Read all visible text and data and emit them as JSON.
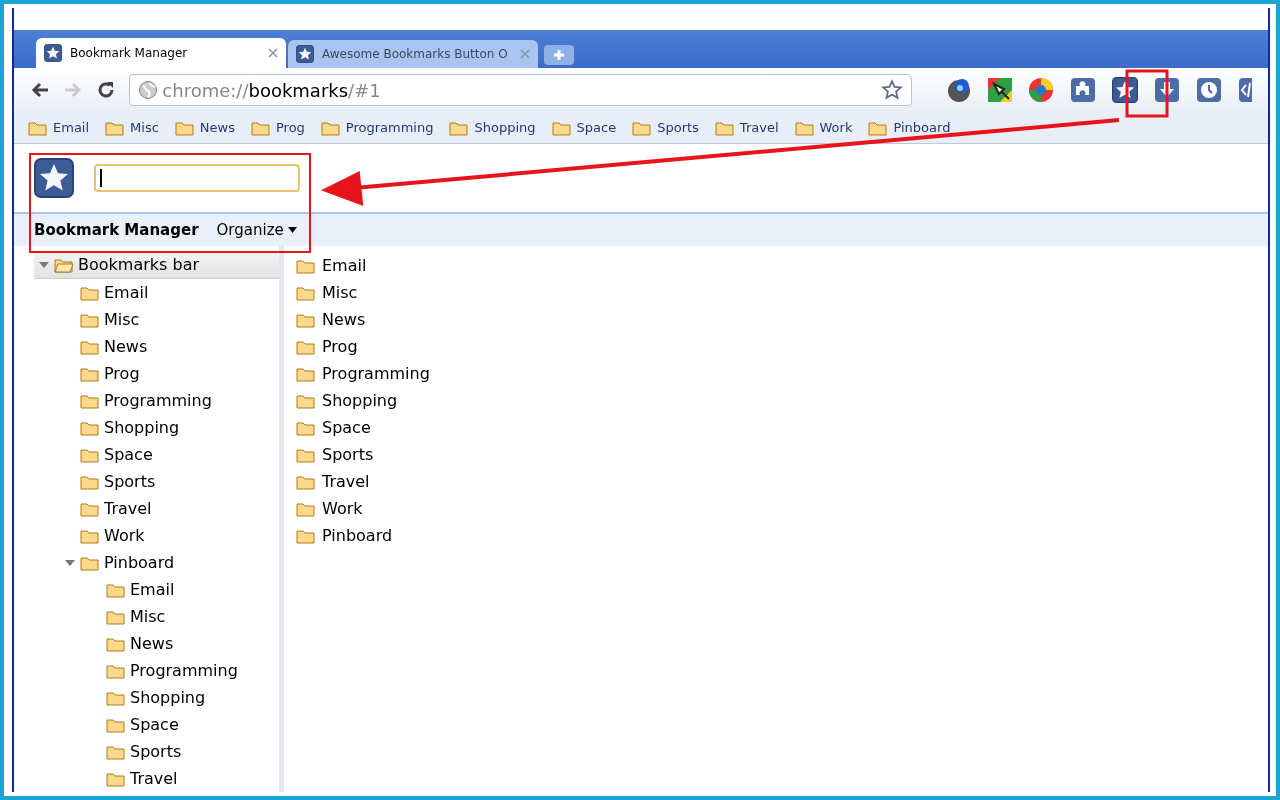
{
  "tabs": [
    {
      "title": "Bookmark Manager",
      "selected": true
    },
    {
      "title": "Awesome Bookmarks Button O",
      "selected": false
    }
  ],
  "address": {
    "scheme": "chrome://",
    "host": "bookmarks",
    "path": "/#1"
  },
  "bookmarks_bar": [
    "Email",
    "Misc",
    "News",
    "Prog",
    "Programming",
    "Shopping",
    "Space",
    "Sports",
    "Travel",
    "Work",
    "Pinboard"
  ],
  "manager": {
    "title": "Bookmark Manager",
    "menu": "Organize",
    "tree": [
      {
        "label": "Bookmarks bar",
        "expanded": true,
        "selected": true,
        "children": [
          {
            "label": "Email"
          },
          {
            "label": "Misc"
          },
          {
            "label": "News"
          },
          {
            "label": "Prog"
          },
          {
            "label": "Programming"
          },
          {
            "label": "Shopping"
          },
          {
            "label": "Space"
          },
          {
            "label": "Sports"
          },
          {
            "label": "Travel"
          },
          {
            "label": "Work"
          },
          {
            "label": "Pinboard",
            "expanded": true,
            "selected": false,
            "children": [
              {
                "label": "Email"
              },
              {
                "label": "Misc"
              },
              {
                "label": "News"
              },
              {
                "label": "Programming"
              },
              {
                "label": "Shopping"
              },
              {
                "label": "Space"
              },
              {
                "label": "Sports"
              },
              {
                "label": "Travel"
              }
            ]
          }
        ]
      }
    ],
    "list": [
      "Email",
      "Misc",
      "News",
      "Prog",
      "Programming",
      "Shopping",
      "Space",
      "Sports",
      "Travel",
      "Work",
      "Pinboard"
    ]
  }
}
